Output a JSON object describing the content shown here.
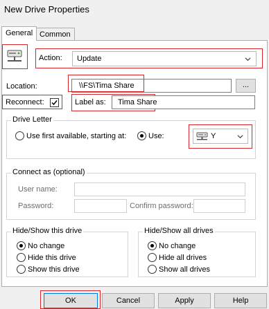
{
  "window": {
    "title": "New Drive Properties"
  },
  "tabs": [
    {
      "label": "General"
    },
    {
      "label": "Common"
    }
  ],
  "action": {
    "label": "Action:",
    "value": "Update"
  },
  "location": {
    "label": "Location:",
    "value": "\\\\FS\\Tima Share",
    "browse_label": "..."
  },
  "reconnect": {
    "label": "Reconnect:",
    "checked": true
  },
  "label_as": {
    "label": "Label as:",
    "value": "Tima Share"
  },
  "drive_letter": {
    "legend": "Drive Letter",
    "first_available_label": "Use first available, starting at:",
    "use_label": "Use:",
    "selected": "use",
    "value": "Y"
  },
  "connect_as": {
    "legend": "Connect as (optional)",
    "user_name_label": "User name:",
    "password_label": "Password:",
    "confirm_password_label": "Confirm password:"
  },
  "hide_show_this": {
    "legend": "Hide/Show this drive",
    "options": [
      "No change",
      "Hide this drive",
      "Show this drive"
    ],
    "selected": 0
  },
  "hide_show_all": {
    "legend": "Hide/Show all drives",
    "options": [
      "No change",
      "Hide all drives",
      "Show all drives"
    ],
    "selected": 0
  },
  "buttons": {
    "ok": "OK",
    "cancel": "Cancel",
    "apply": "Apply",
    "help": "Help"
  },
  "colors": {
    "highlight": "#d9262b",
    "focus": "#0078d7"
  },
  "icons": {
    "drive": "network-drive-icon",
    "combo": "chevron-down-icon"
  }
}
